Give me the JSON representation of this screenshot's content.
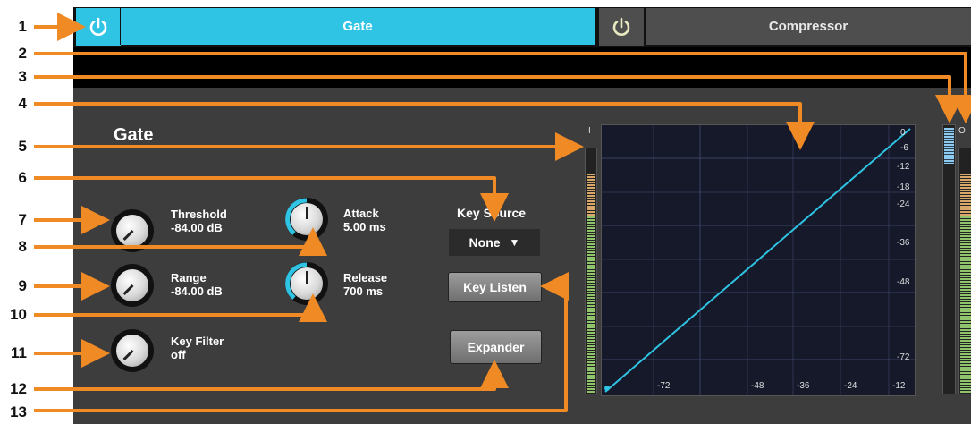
{
  "tabs": [
    {
      "label": "Gate",
      "active": true
    },
    {
      "label": "Compressor",
      "active": false
    }
  ],
  "panel": {
    "title": "Gate",
    "knobs": [
      {
        "label": "Threshold",
        "value": "-84.00 dB"
      },
      {
        "label": "Attack",
        "value": "5.00 ms"
      },
      {
        "label": "Range",
        "value": "-84.00 dB"
      },
      {
        "label": "Release",
        "value": "700 ms"
      },
      {
        "label": "Key Filter",
        "value": "off"
      }
    ],
    "key_source": {
      "label": "Key Source",
      "selected": "None",
      "arrow": "▼"
    },
    "buttons": {
      "key_listen": "Key Listen",
      "expander": "Expander"
    }
  },
  "meters": {
    "input_label": "I",
    "output_label": "O"
  },
  "graph": {
    "x_ticks": [
      "-72",
      "-48",
      "-36",
      "-24",
      "-12"
    ],
    "y_ticks": [
      "0",
      "-6",
      "-12",
      "-18",
      "-24",
      "-36",
      "-48",
      "-72"
    ]
  },
  "callouts": [
    "1",
    "2",
    "3",
    "4",
    "5",
    "6",
    "7",
    "8",
    "9",
    "10",
    "11",
    "12",
    "13"
  ],
  "colors": {
    "accent": "#2fc4e3",
    "callout_line": "#f08a24",
    "panel_bg": "#3d3d3d"
  }
}
